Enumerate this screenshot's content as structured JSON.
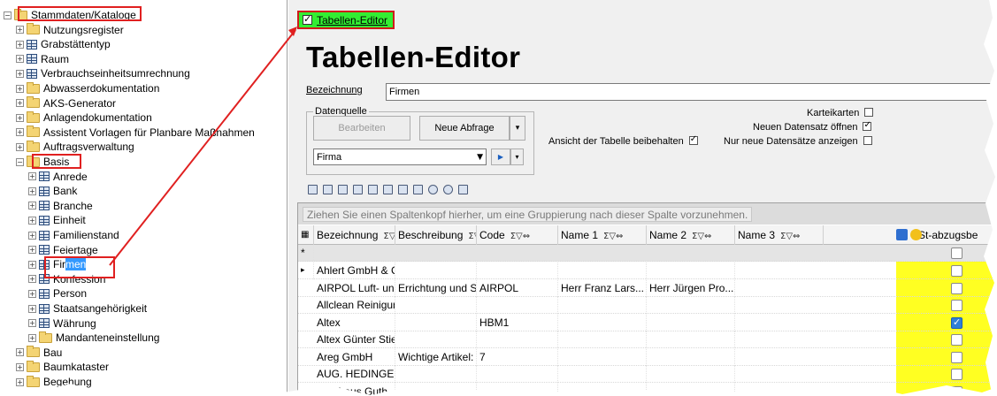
{
  "tree": {
    "items": [
      {
        "label": "Stammdaten/Kataloge",
        "icon": "folder-icon",
        "exp": "⊟"
      },
      {
        "label": "Nutzungsregister",
        "icon": "folder-icon",
        "exp": "⊞"
      },
      {
        "label": "Grabstättentyp",
        "icon": "table-icon",
        "exp": "⊞"
      },
      {
        "label": "Raum",
        "icon": "table-icon",
        "exp": "⊞"
      },
      {
        "label": "Verbrauchseinheitsumrechnung",
        "icon": "table-icon",
        "exp": "⊞"
      },
      {
        "label": "Abwasserdokumentation",
        "icon": "folder-icon",
        "exp": "⊞"
      },
      {
        "label": "AKS-Generator",
        "icon": "folder-icon",
        "exp": "⊞"
      },
      {
        "label": "Anlagendokumentation",
        "icon": "folder-icon",
        "exp": "⊞"
      },
      {
        "label": "Assistent Vorlagen für Planbare Maßnahmen",
        "icon": "folder-icon",
        "exp": "⊞"
      },
      {
        "label": "Auftragsverwaltung",
        "icon": "folder-icon",
        "exp": "⊞"
      },
      {
        "label": "Basis",
        "icon": "folder-icon",
        "exp": "⊟"
      },
      {
        "label": "Anrede",
        "icon": "table-icon",
        "exp": "⊞"
      },
      {
        "label": "Bank",
        "icon": "table-icon",
        "exp": "⊞"
      },
      {
        "label": "Branche",
        "icon": "table-icon",
        "exp": "⊞"
      },
      {
        "label": "Einheit",
        "icon": "table-icon",
        "exp": "⊞"
      },
      {
        "label": "Familienstand",
        "icon": "table-icon",
        "exp": "⊞"
      },
      {
        "label": "Feiertage",
        "icon": "table-icon",
        "exp": "⊞"
      },
      {
        "label": "Firmen",
        "icon": "table-icon",
        "exp": "⊞"
      },
      {
        "label": "Konfession",
        "icon": "table-icon",
        "exp": "⊞"
      },
      {
        "label": "Person",
        "icon": "table-icon",
        "exp": "⊞"
      },
      {
        "label": "Staatsangehörigkeit",
        "icon": "table-icon",
        "exp": "⊞"
      },
      {
        "label": "Währung",
        "icon": "table-icon",
        "exp": "⊞"
      },
      {
        "label": "Mandanteneinstellung",
        "icon": "folder-icon",
        "exp": "⊞"
      },
      {
        "label": "Bau",
        "icon": "folder-icon",
        "exp": "⊞"
      },
      {
        "label": "Baumkataster",
        "icon": "folder-icon",
        "exp": "⊞"
      },
      {
        "label": "Begehung",
        "icon": "folder-icon",
        "exp": "⊞"
      }
    ]
  },
  "editor": {
    "tab_label": "Tabellen-Editor",
    "title": "Tabellen-Editor",
    "bezeichnung_label": "Bezeichnung",
    "bezeichnung_value": "Firmen",
    "datenquelle_label": "Datenquelle",
    "bearbeiten_label": "Bearbeiten",
    "neue_abfrage_label": "Neue Abfrage",
    "source_value": "Firma",
    "ansicht_label": "Ansicht der Tabelle beibehalten",
    "karteikarten_label": "Karteikarten",
    "neuen_datensatz_label": "Neuen Datensatz öffnen",
    "nur_neue_label": "Nur neue Datensätze anzeigen",
    "group_hint": "Ziehen Sie einen Spaltenkopf hierher, um eine Gruppierung nach dieser Spalte vorzunehmen."
  },
  "grid": {
    "columns": [
      "Bezeichnung",
      "Beschreibung",
      "Code",
      "Name 1",
      "Name 2",
      "Name 3",
      "VSt-abzugsbe"
    ],
    "filter_symbols": "Σ▽⇔",
    "rows": [
      {
        "bez": "Ahlert GmbH & Co...",
        "besch": "",
        "code": "",
        "n1": "",
        "n2": "",
        "vst": false
      },
      {
        "bez": "AIRPOL Luft- und...",
        "besch": "Errichtung und Servi...",
        "code": "AIRPOL",
        "n1": "Herr Franz Lars...",
        "n2": "Herr Jürgen Pro...",
        "vst": false
      },
      {
        "bez": "Allclean Reinigungs...",
        "besch": "",
        "code": "",
        "n1": "",
        "n2": "",
        "vst": false
      },
      {
        "bez": "Altex",
        "besch": "",
        "code": "HBM1",
        "n1": "",
        "n2": "",
        "vst": true
      },
      {
        "bez": "Altex Günter Stien...",
        "besch": "",
        "code": "",
        "n1": "",
        "n2": "",
        "vst": false
      },
      {
        "bez": "Areg GmbH",
        "besch": "Wichtige Artikel: Ant...",
        "code": "7",
        "n1": "",
        "n2": "",
        "vst": false
      },
      {
        "bez": "AUG. HEDINGER...",
        "besch": "",
        "code": "",
        "n1": "",
        "n2": "",
        "vst": false
      },
      {
        "bez": "Autohaus Guth...",
        "besch": "",
        "code": "",
        "n1": "",
        "n2": "",
        "vst": false
      }
    ],
    "new_row_marker": "*",
    "current_row_marker": "▸"
  },
  "colors": {
    "accent_green": "#33ee33",
    "highlight_red": "#e02020",
    "vst_yellow": "#ffff22",
    "selection_blue": "#3399ff"
  }
}
